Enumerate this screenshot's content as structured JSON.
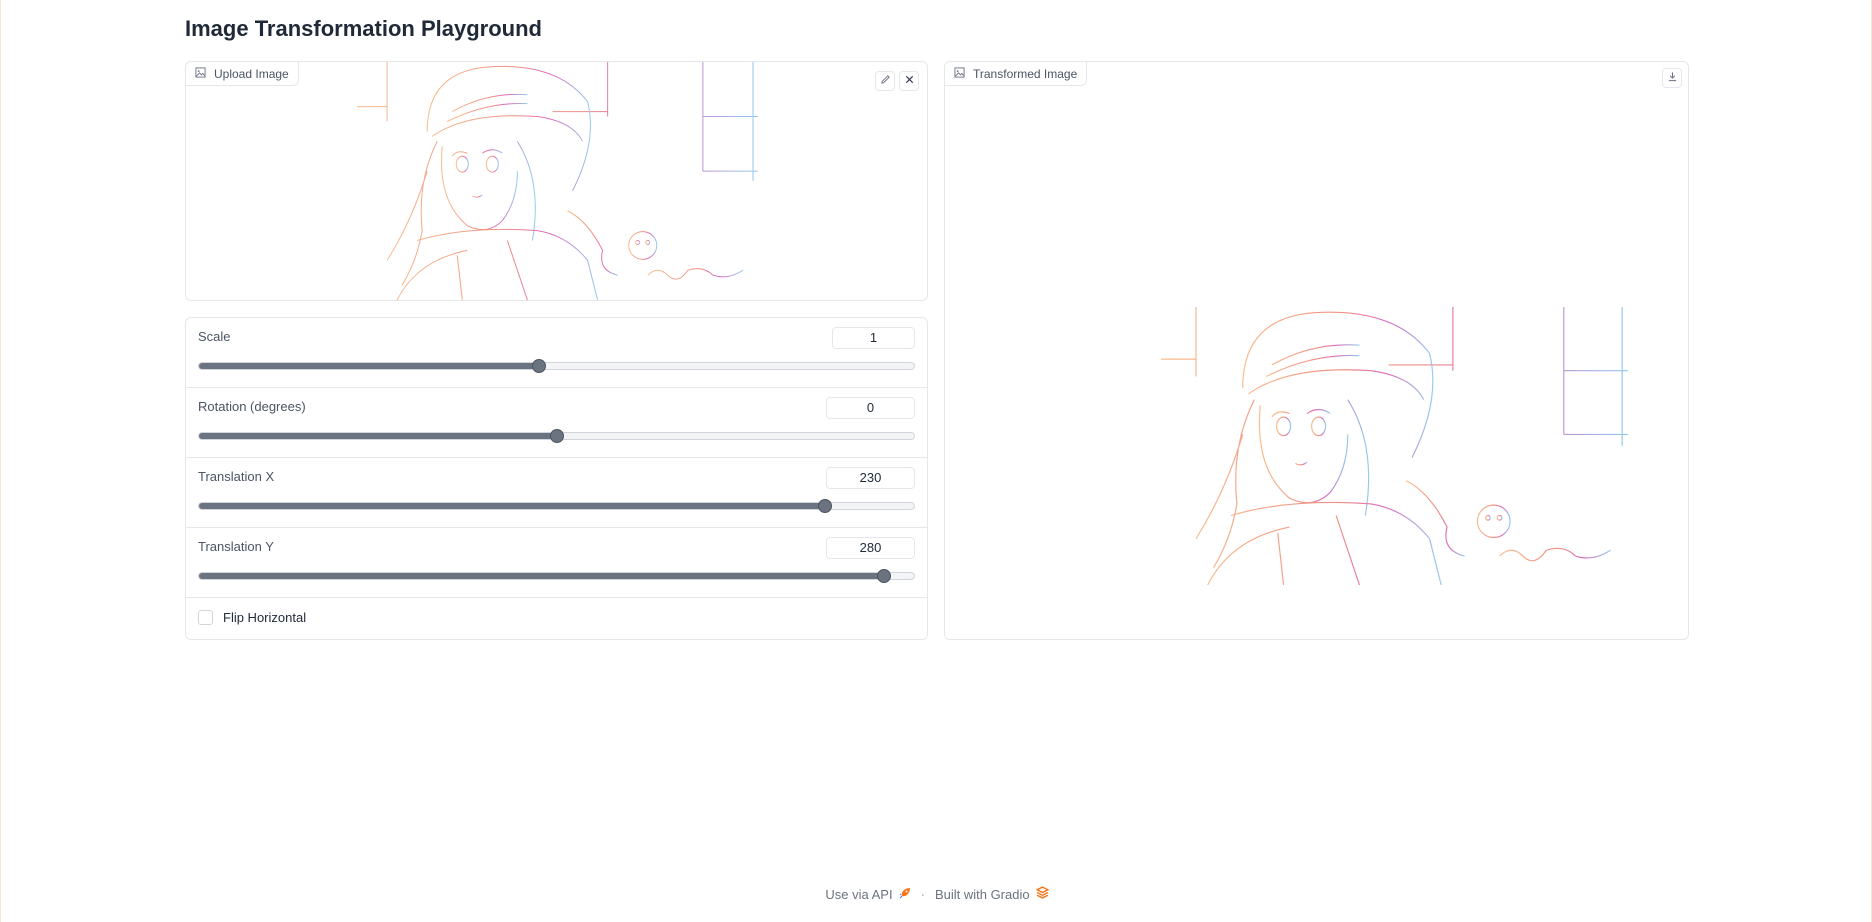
{
  "app": {
    "title": "Image Transformation Playground"
  },
  "upload": {
    "label": "Upload Image",
    "icon": "image-icon",
    "edit_icon": "pencil-icon",
    "clear_icon": "close-icon"
  },
  "output": {
    "label": "Transformed Image",
    "icon": "image-icon",
    "download_icon": "download-icon"
  },
  "controls": {
    "scale": {
      "label": "Scale",
      "value": "1",
      "fraction": 0.475
    },
    "rotation": {
      "label": "Rotation (degrees)",
      "value": "0",
      "fraction": 0.5
    },
    "translation_x": {
      "label": "Translation X",
      "value": "230",
      "fraction": 0.875
    },
    "translation_y": {
      "label": "Translation Y",
      "value": "280",
      "fraction": 0.958
    },
    "flip": {
      "label": "Flip Horizontal",
      "checked": false
    }
  },
  "footer": {
    "api": "Use via API",
    "separator": "·",
    "built": "Built with Gradio"
  },
  "colors": {
    "slider": "#6b7280",
    "sketch_warm": "#f4a06b",
    "sketch_pink": "#e05a9a",
    "sketch_blue": "#6bb6e8"
  }
}
